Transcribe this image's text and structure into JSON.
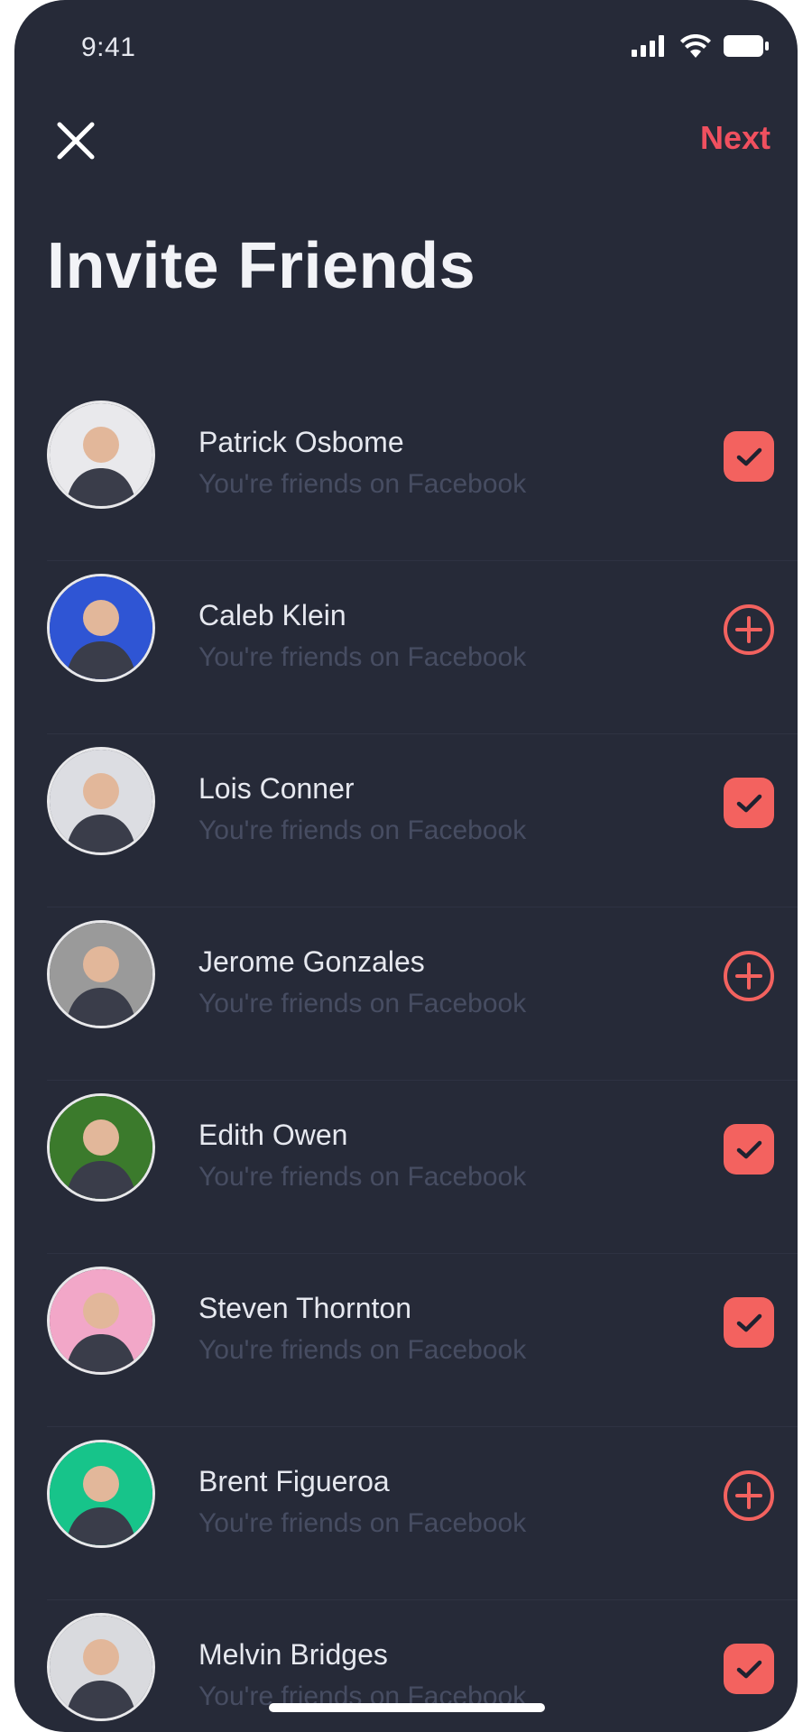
{
  "status_bar": {
    "time": "9:41",
    "icons": [
      "cellular-signal-icon",
      "wifi-icon",
      "battery-icon"
    ]
  },
  "header": {
    "close_icon": "close-icon",
    "next_label": "Next",
    "title": "Invite Friends"
  },
  "colors": {
    "background": "#262a38",
    "accent": "#f3625f",
    "next_text": "#f0505f",
    "name_text": "#e6e8ef",
    "sub_text": "#474d62"
  },
  "friends": [
    {
      "name": "Patrick Osbome",
      "subtitle": "You're friends on Facebook",
      "state": "checked",
      "avatar_bg": "#e9e9ec"
    },
    {
      "name": "Caleb Klein",
      "subtitle": "You're friends on Facebook",
      "state": "add",
      "avatar_bg": "#2f55d4"
    },
    {
      "name": "Lois Conner",
      "subtitle": "You're friends on Facebook",
      "state": "checked",
      "avatar_bg": "#dcdde2"
    },
    {
      "name": "Jerome Gonzales",
      "subtitle": "You're friends on Facebook",
      "state": "add",
      "avatar_bg": "#9a9a9a"
    },
    {
      "name": "Edith Owen",
      "subtitle": "You're friends on Facebook",
      "state": "checked",
      "avatar_bg": "#3b7a2c"
    },
    {
      "name": "Steven Thornton",
      "subtitle": "You're friends on Facebook",
      "state": "checked",
      "avatar_bg": "#f2a7c8"
    },
    {
      "name": "Brent Figueroa",
      "subtitle": "You're friends on Facebook",
      "state": "add",
      "avatar_bg": "#17c48a"
    },
    {
      "name": "Melvin Bridges",
      "subtitle": "You're friends on Facebook",
      "state": "checked",
      "avatar_bg": "#d9dade"
    }
  ]
}
